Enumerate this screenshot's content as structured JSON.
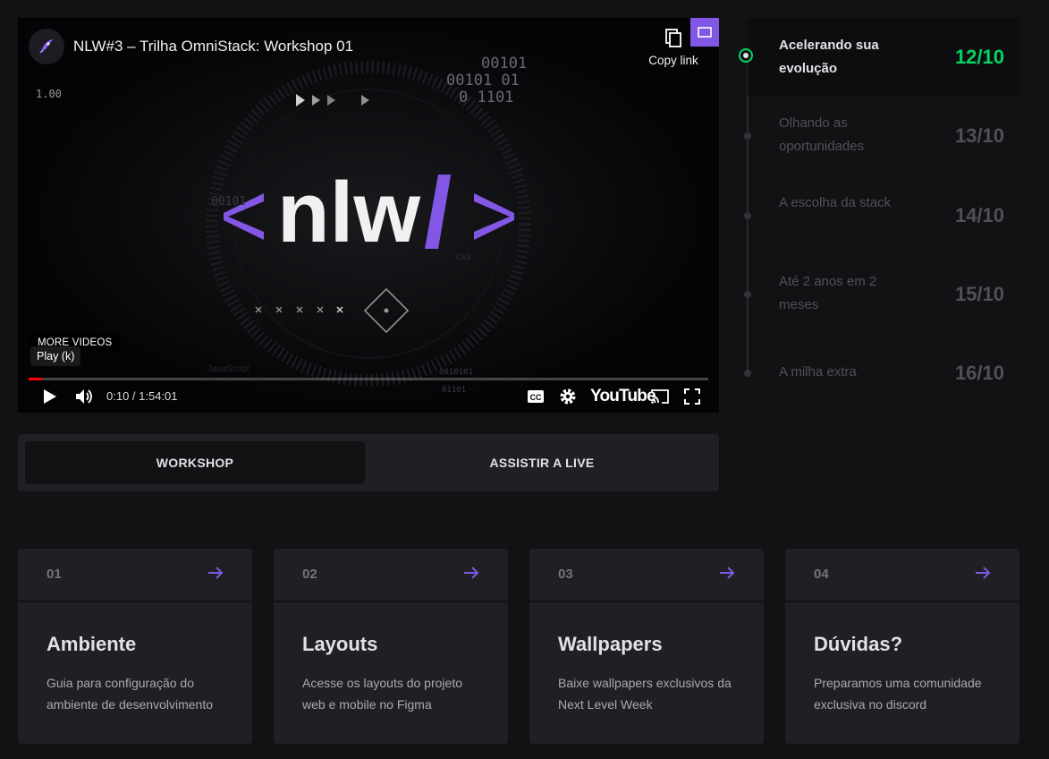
{
  "player": {
    "title": "NLW#3 – Trilha OmniStack: Workshop 01",
    "copy_link": "Copy link",
    "speed": "1.00",
    "more_videos": "MORE VIDEOS",
    "tooltip": "Play (k)",
    "time": "0:10 / 1:54:01",
    "progress": 0.0015,
    "youtube_logo": "YouTube",
    "logo_text": "nlw",
    "binary_1": "00101",
    "binary_2": "00101 01",
    "binary_3": "0 1101",
    "binary_4": "00101",
    "binary_5": "0010101",
    "binary_6": "01101",
    "css_label": "css",
    "js_label": "JavaScript",
    "icons": [
      "rocket-icon",
      "copy-icon",
      "miniplayer-icon",
      "play-icon",
      "volume-icon",
      "cc-icon",
      "settings-icon",
      "cast-icon",
      "fullscreen-icon"
    ]
  },
  "tabs": [
    {
      "label": "WORKSHOP",
      "active": true
    },
    {
      "label": "ASSISTIR A LIVE",
      "active": false
    }
  ],
  "schedule": [
    {
      "title": "Acelerando sua evolução",
      "date": "12/10",
      "active": true
    },
    {
      "title": "Olhando as oportunidades",
      "date": "13/10",
      "active": false
    },
    {
      "title": "A escolha da stack",
      "date": "14/10",
      "active": false
    },
    {
      "title": "Até 2 anos em 2 meses",
      "date": "15/10",
      "active": false
    },
    {
      "title": "A milha extra",
      "date": "16/10",
      "active": false
    }
  ],
  "cards": [
    {
      "number": "01",
      "title": "Ambiente",
      "description": "Guia para configuração do ambiente de desenvolvimento"
    },
    {
      "number": "02",
      "title": "Layouts",
      "description": "Acesse os layouts do projeto web e mobile no Figma"
    },
    {
      "number": "03",
      "title": "Wallpapers",
      "description": "Baixe wallpapers exclusivos da Next Level Week"
    },
    {
      "number": "04",
      "title": "Dúvidas?",
      "description": "Preparamos uma comunidade exclusiva no discord"
    }
  ],
  "colors": {
    "background": "#121214",
    "surface": "#202024",
    "accent_purple": "#8257e5",
    "accent_green": "#04d361",
    "muted_text": "#505059"
  }
}
